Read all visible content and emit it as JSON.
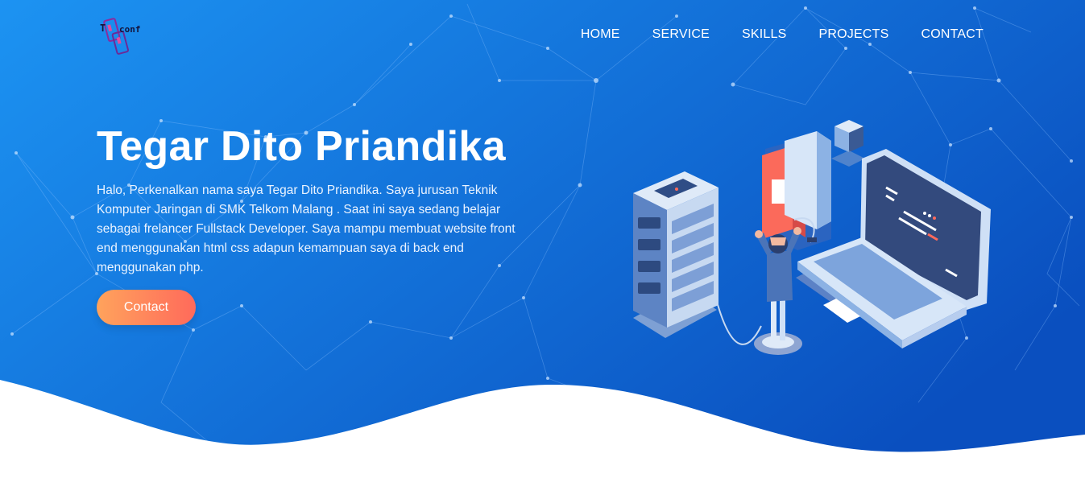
{
  "brand": {
    "logo_letter": "T",
    "logo_text": "conf"
  },
  "nav": {
    "items": [
      {
        "label": "HOME"
      },
      {
        "label": "SERVICE"
      },
      {
        "label": "SKILLS"
      },
      {
        "label": "PROJECTS"
      },
      {
        "label": "CONTACT"
      }
    ]
  },
  "hero": {
    "title": "Tegar Dito Priandika",
    "description": "Halo, Perkenalkan nama saya Tegar Dito Priandika. Saya jurusan Teknik Komputer Jaringan di SMK Telkom Malang . Saat ini saya sedang belajar sebagai frelancer Fullstack Developer. Saya mampu membuat website front end menggunakan html css adapun kemampuan saya di back end menggunakan php.",
    "cta_label": "Contact"
  },
  "colors": {
    "hero_start": "#1a8ef0",
    "hero_end": "#0a55c4",
    "cta_start": "#ffa35c",
    "cta_end": "#ff6a5b"
  },
  "illustration": {
    "icon": "server-laptop-developer-illustration"
  }
}
